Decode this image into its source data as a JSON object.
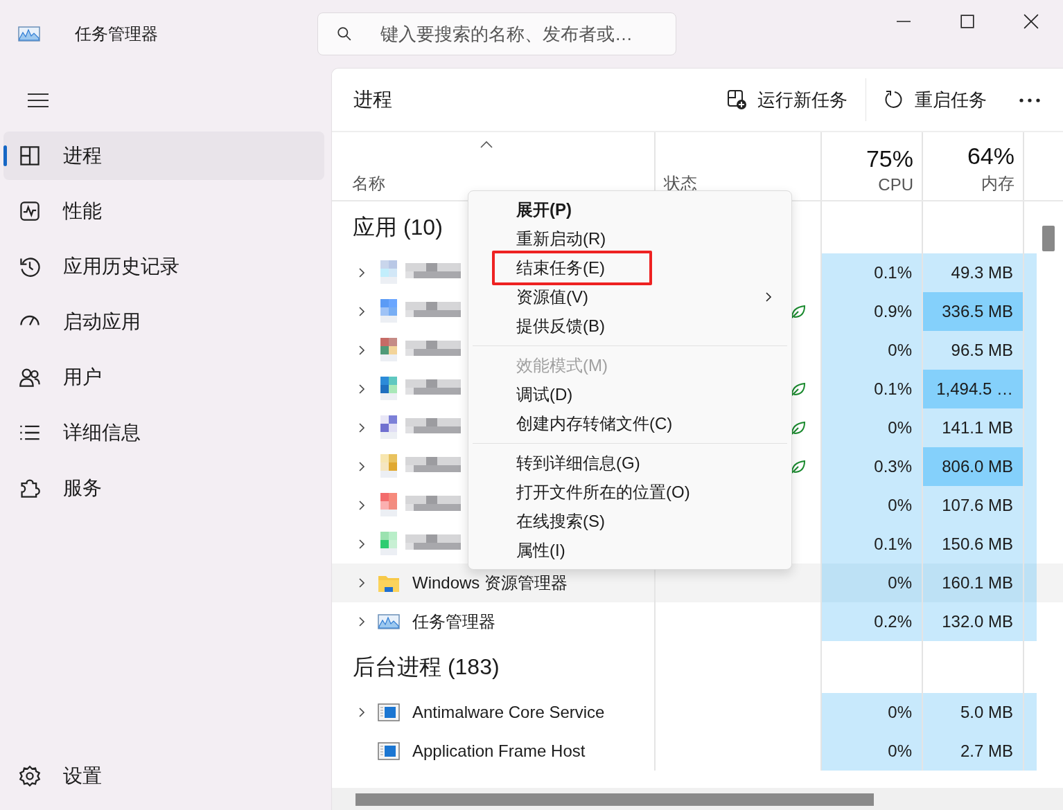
{
  "window": {
    "title": "任务管理器",
    "search_placeholder": "键入要搜索的名称、发布者或…"
  },
  "sidebar": {
    "items": [
      {
        "label": "进程",
        "selected": true
      },
      {
        "label": "性能",
        "selected": false
      },
      {
        "label": "应用历史记录",
        "selected": false
      },
      {
        "label": "启动应用",
        "selected": false
      },
      {
        "label": "用户",
        "selected": false
      },
      {
        "label": "详细信息",
        "selected": false
      },
      {
        "label": "服务",
        "selected": false
      }
    ],
    "settings": "设置"
  },
  "toolbar": {
    "title": "进程",
    "run_task": "运行新任务",
    "restart_task": "重启任务"
  },
  "table": {
    "name_header": "名称",
    "status_header": "状态",
    "cpu": {
      "total": "75%",
      "label": "CPU"
    },
    "memory": {
      "total": "64%",
      "label": "内存"
    },
    "sections": [
      {
        "title": "应用 (10)",
        "rows": [
          {
            "kind": "pixelated",
            "expandable": true,
            "efficiency": false,
            "cpu": "0.1%",
            "memory": "49.3 MB",
            "memory_high": false,
            "selected": false
          },
          {
            "kind": "pixelated",
            "expandable": true,
            "efficiency": true,
            "cpu": "0.9%",
            "memory": "336.5 MB",
            "memory_high": true,
            "selected": false
          },
          {
            "kind": "pixelated",
            "expandable": true,
            "efficiency": false,
            "cpu": "0%",
            "memory": "96.5 MB",
            "memory_high": false,
            "selected": false
          },
          {
            "kind": "pixelated",
            "expandable": true,
            "efficiency": true,
            "cpu": "0.1%",
            "memory": "1,494.5 …",
            "memory_high": true,
            "selected": false
          },
          {
            "kind": "pixelated",
            "expandable": true,
            "efficiency": true,
            "cpu": "0%",
            "memory": "141.1 MB",
            "memory_high": false,
            "selected": false
          },
          {
            "kind": "pixelated",
            "expandable": true,
            "efficiency": true,
            "cpu": "0.3%",
            "memory": "806.0 MB",
            "memory_high": true,
            "selected": false
          },
          {
            "kind": "pixelated",
            "expandable": true,
            "efficiency": false,
            "cpu": "0%",
            "memory": "107.6 MB",
            "memory_high": false,
            "selected": false
          },
          {
            "kind": "pixelated",
            "expandable": true,
            "efficiency": false,
            "cpu": "0.1%",
            "memory": "150.6 MB",
            "memory_high": false,
            "selected": false
          },
          {
            "kind": "folder",
            "name": "Windows 资源管理器",
            "expandable": true,
            "efficiency": false,
            "cpu": "0%",
            "memory": "160.1 MB",
            "memory_high": false,
            "selected": true
          },
          {
            "kind": "monitor",
            "name": "任务管理器",
            "expandable": true,
            "efficiency": false,
            "cpu": "0.2%",
            "memory": "132.0 MB",
            "memory_high": false,
            "selected": false
          }
        ]
      },
      {
        "title": "后台进程 (183)",
        "rows": [
          {
            "kind": "app",
            "name": "Antimalware Core Service",
            "expandable": true,
            "efficiency": false,
            "cpu": "0%",
            "memory": "5.0 MB",
            "memory_high": false,
            "selected": false
          },
          {
            "kind": "app",
            "name": "Application Frame Host",
            "expandable": false,
            "efficiency": false,
            "cpu": "0%",
            "memory": "2.7 MB",
            "memory_high": false,
            "selected": false
          }
        ]
      }
    ]
  },
  "context_menu": {
    "groups": [
      [
        {
          "label": "展开(P)",
          "bold": true,
          "disabled": false,
          "submenu": false,
          "annotated": false
        },
        {
          "label": "重新启动(R)",
          "bold": false,
          "disabled": false,
          "submenu": false,
          "annotated": false
        },
        {
          "label": "结束任务(E)",
          "bold": false,
          "disabled": false,
          "submenu": false,
          "annotated": true
        },
        {
          "label": "资源值(V)",
          "bold": false,
          "disabled": false,
          "submenu": true,
          "annotated": false
        },
        {
          "label": "提供反馈(B)",
          "bold": false,
          "disabled": false,
          "submenu": false,
          "annotated": false
        }
      ],
      [
        {
          "label": "效能模式(M)",
          "bold": false,
          "disabled": true,
          "submenu": false,
          "annotated": false
        },
        {
          "label": "调试(D)",
          "bold": false,
          "disabled": false,
          "submenu": false,
          "annotated": false
        },
        {
          "label": "创建内存转储文件(C)",
          "bold": false,
          "disabled": false,
          "submenu": false,
          "annotated": false
        }
      ],
      [
        {
          "label": "转到详细信息(G)",
          "bold": false,
          "disabled": false,
          "submenu": false,
          "annotated": false
        },
        {
          "label": "打开文件所在的位置(O)",
          "bold": false,
          "disabled": false,
          "submenu": false,
          "annotated": false
        },
        {
          "label": "在线搜索(S)",
          "bold": false,
          "disabled": false,
          "submenu": false,
          "annotated": false
        },
        {
          "label": "属性(I)",
          "bold": false,
          "disabled": false,
          "submenu": false,
          "annotated": false
        }
      ]
    ]
  }
}
